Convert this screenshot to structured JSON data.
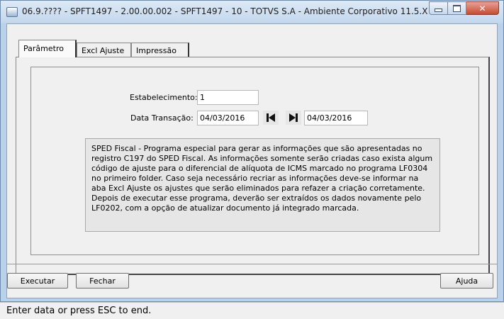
{
  "window": {
    "title": "06.9.???? - SPFT1497 - 2.00.00.002 - SPFT1497 - 10 - TOTVS S.A - Ambiente Corporativo 11.5.X ..."
  },
  "tabs": [
    {
      "label": "Parâmetro",
      "active": true
    },
    {
      "label": "Excl Ajuste",
      "active": false
    },
    {
      "label": "Impressão",
      "active": false
    }
  ],
  "form": {
    "estabelecimento_label": "Estabelecimento:",
    "estabelecimento_value": "1",
    "data_transacao_label": "Data Transação:",
    "data_inicial_value": "04/03/2016",
    "data_final_value": "04/03/2016"
  },
  "description": "SPED Fiscal - Programa especial para gerar as informações que são apresentadas no registro C197 do SPED Fiscal. As informações somente serão criadas caso exista algum código de ajuste para o diferencial de alíquota de ICMS marcado no programa LF0304 no primeiro folder. Caso seja necessário recriar as informações deve-se informar na aba Excl Ajuste os ajustes que serão eliminados para refazer a criação corretamente. Depois de executar esse programa, deverão ser extraídos os dados novamente pelo LF0202, com a opção de atualizar documento já integrado marcada.",
  "buttons": {
    "executar": "Executar",
    "fechar": "Fechar",
    "ajuda": "Ajuda"
  },
  "status": {
    "text": "Enter data or press ESC to end."
  },
  "icons": {
    "window": "app-window-icon",
    "first": "skip-first-icon",
    "last": "skip-last-icon"
  },
  "colors": {
    "frame": "#b9d1ea",
    "close_button": "#c74a33",
    "panel": "#f0f0f0",
    "description_bg": "#e6e6e6"
  }
}
